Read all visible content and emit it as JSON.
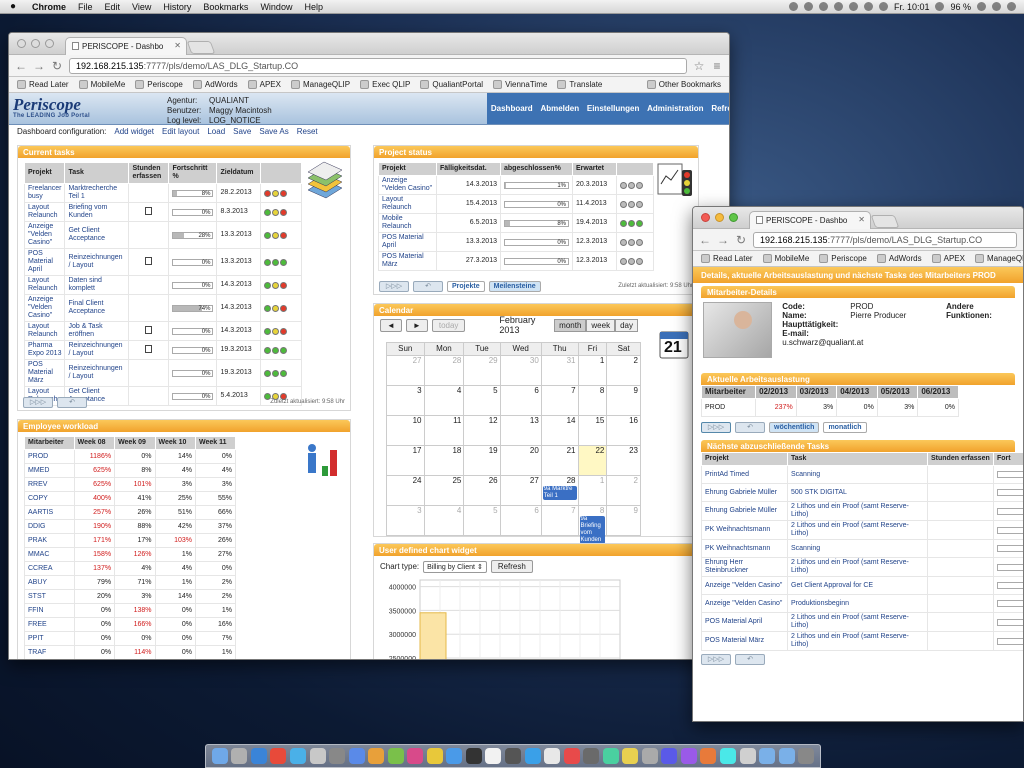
{
  "menubar": {
    "app": "Chrome",
    "items": [
      "File",
      "Edit",
      "View",
      "History",
      "Bookmarks",
      "Window",
      "Help"
    ],
    "battery": "96 %",
    "clock": "Fr. 10:01"
  },
  "browser": {
    "tab_title": "PERISCOPE - Dashbo",
    "url_host": "192.168.215.135",
    "url_path": ":7777/pls/demo/LAS_DLG_Startup.CO",
    "bookmarks": [
      "Read Later",
      "MobileMe",
      "Periscope",
      "AdWords",
      "APEX",
      "ManageQLIP",
      "Exec QLIP",
      "QualiantPortal",
      "ViennaTime",
      "Translate"
    ],
    "bookmarks_other": "Other Bookmarks"
  },
  "app": {
    "logo": "Periscope",
    "tagline": "The LEADING Job Portal",
    "agentur_label": "Agentur:",
    "agentur": "QUALIANT",
    "benutzer_label": "Benutzer:",
    "benutzer": "Maggy Macintosh",
    "loglevel_label": "Log level:",
    "loglevel": "LOG_NOTICE",
    "nav": [
      "Dashboard",
      "Abmelden",
      "Einstellungen",
      "Administration",
      "Refresh"
    ],
    "dashconf_label": "Dashboard configuration:",
    "dashconf": [
      "Add widget",
      "Edit layout",
      "Load",
      "Save",
      "Save As",
      "Reset"
    ]
  },
  "current_tasks": {
    "title": "Current tasks",
    "headers": [
      "Projekt",
      "Task",
      "Stunden erfassen",
      "Fortschritt %",
      "Zieldatum",
      ""
    ],
    "rows": [
      {
        "projekt": "Freelancer busy",
        "task": "Marktrecherche Teil 1",
        "doc": false,
        "pct": 8,
        "pct_label": "8%",
        "date": "28.2.2013",
        "lights": "ryr"
      },
      {
        "projekt": "Layout Relaunch",
        "task": "Briefing vom Kunden",
        "doc": true,
        "pct": 0,
        "pct_label": "0%",
        "date": "8.3.2013",
        "lights": "gyr"
      },
      {
        "projekt": "Anzeige \"Velden Casino\"",
        "task": "Get Client Acceptance",
        "doc": false,
        "pct": 28,
        "pct_label": "28%",
        "date": "13.3.2013",
        "lights": "gyr"
      },
      {
        "projekt": "POS Material April",
        "task": "Reinzeichnungen / Layout",
        "doc": true,
        "pct": 0,
        "pct_label": "0%",
        "date": "13.3.2013",
        "lights": "ggg"
      },
      {
        "projekt": "Layout Relaunch",
        "task": "Daten sind komplett",
        "doc": false,
        "pct": 0,
        "pct_label": "0%",
        "date": "14.3.2013",
        "lights": "gyr"
      },
      {
        "projekt": "Anzeige \"Velden Casino\"",
        "task": "Final Client Acceptance",
        "doc": false,
        "pct": 74,
        "pct_label": "74%",
        "date": "14.3.2013",
        "lights": "gyr"
      },
      {
        "projekt": "Layout Relaunch",
        "task": "Job & Task eröffnen",
        "doc": true,
        "pct": 0,
        "pct_label": "0%",
        "date": "14.3.2013",
        "lights": "gyr"
      },
      {
        "projekt": "Pharma Expo 2013",
        "task": "Reinzeichnungen / Layout",
        "doc": true,
        "pct": 0,
        "pct_label": "0%",
        "date": "19.3.2013",
        "lights": "ggg"
      },
      {
        "projekt": "POS Material März",
        "task": "Reinzeichnungen / Layout",
        "doc": false,
        "pct": 0,
        "pct_label": "0%",
        "date": "19.3.2013",
        "lights": "ggg"
      },
      {
        "projekt": "Layout Relaunch",
        "task": "Get Client Acceptance",
        "doc": false,
        "pct": 0,
        "pct_label": "0%",
        "date": "5.4.2013",
        "lights": "gyr"
      }
    ],
    "updated": "Zuletzt aktualisiert: 9:58 Uhr"
  },
  "employee_workload": {
    "title": "Employee workload",
    "headers": [
      "Mitarbeiter",
      "Week 08",
      "Week 09",
      "Week 10",
      "Week 11"
    ],
    "rows": [
      {
        "name": "PROD",
        "w": [
          "1186%",
          "0%",
          "14%",
          "0%"
        ],
        "red": [
          true,
          false,
          false,
          false
        ]
      },
      {
        "name": "MMED",
        "w": [
          "625%",
          "8%",
          "4%",
          "4%"
        ],
        "red": [
          true,
          false,
          false,
          false
        ]
      },
      {
        "name": "RREV",
        "w": [
          "625%",
          "101%",
          "3%",
          "3%"
        ],
        "red": [
          true,
          true,
          false,
          false
        ]
      },
      {
        "name": "COPY",
        "w": [
          "400%",
          "41%",
          "25%",
          "55%"
        ],
        "red": [
          true,
          false,
          false,
          false
        ]
      },
      {
        "name": "AARTIS",
        "w": [
          "257%",
          "26%",
          "51%",
          "66%"
        ],
        "red": [
          true,
          false,
          false,
          false
        ]
      },
      {
        "name": "DDIG",
        "w": [
          "190%",
          "88%",
          "42%",
          "37%"
        ],
        "red": [
          true,
          false,
          false,
          false
        ]
      },
      {
        "name": "PRAK",
        "w": [
          "171%",
          "17%",
          "103%",
          "26%"
        ],
        "red": [
          true,
          false,
          true,
          false
        ]
      },
      {
        "name": "MMAC",
        "w": [
          "158%",
          "126%",
          "1%",
          "27%"
        ],
        "red": [
          true,
          true,
          false,
          false
        ]
      },
      {
        "name": "CCREA",
        "w": [
          "137%",
          "4%",
          "4%",
          "0%"
        ],
        "red": [
          true,
          false,
          false,
          false
        ]
      },
      {
        "name": "ABUY",
        "w": [
          "79%",
          "71%",
          "1%",
          "2%"
        ],
        "red": [
          false,
          false,
          false,
          false
        ]
      },
      {
        "name": "STST",
        "w": [
          "20%",
          "3%",
          "14%",
          "2%"
        ],
        "red": [
          false,
          false,
          false,
          false
        ]
      },
      {
        "name": "FFIN",
        "w": [
          "0%",
          "138%",
          "0%",
          "1%"
        ],
        "red": [
          false,
          true,
          false,
          false
        ]
      },
      {
        "name": "FREE",
        "w": [
          "0%",
          "166%",
          "0%",
          "16%"
        ],
        "red": [
          false,
          true,
          false,
          false
        ]
      },
      {
        "name": "PPIT",
        "w": [
          "0%",
          "0%",
          "0%",
          "7%"
        ],
        "red": [
          false,
          false,
          false,
          false
        ]
      },
      {
        "name": "TRAF",
        "w": [
          "0%",
          "114%",
          "0%",
          "1%"
        ],
        "red": [
          false,
          true,
          false,
          false
        ]
      }
    ]
  },
  "project_status": {
    "title": "Project status",
    "headers": [
      "Projekt",
      "Fälligkeitsdat.",
      "abgeschlossen%",
      "Erwartet",
      ""
    ],
    "rows": [
      {
        "projekt": "Anzeige \"Velden Casino\"",
        "date": "14.3.2013",
        "pct": 1,
        "pct_label": "1%",
        "exp": "20.3.2013",
        "lights": "nnn"
      },
      {
        "projekt": "Layout Relaunch",
        "date": "15.4.2013",
        "pct": 0,
        "pct_label": "0%",
        "exp": "11.4.2013",
        "lights": "nnn"
      },
      {
        "projekt": "Mobile Relaunch",
        "date": "6.5.2013",
        "pct": 8,
        "pct_label": "8%",
        "exp": "19.4.2013",
        "lights": "ggg"
      },
      {
        "projekt": "POS Material April",
        "date": "13.3.2013",
        "pct": 0,
        "pct_label": "0%",
        "exp": "12.3.2013",
        "lights": "nnn"
      },
      {
        "projekt": "POS Material März",
        "date": "27.3.2013",
        "pct": 0,
        "pct_label": "0%",
        "exp": "12.3.2013",
        "lights": "nnn"
      }
    ],
    "tabs": [
      "Projekte",
      "Meilensteine"
    ],
    "updated": "Zuletzt aktualisiert: 9:58 Uhr"
  },
  "calendar": {
    "title": "Calendar",
    "today_label": "today",
    "month_title": "February 2013",
    "views": [
      "month",
      "week",
      "day"
    ],
    "weekdays": [
      "Sun",
      "Mon",
      "Tue",
      "Wed",
      "Thu",
      "Fri",
      "Sat"
    ],
    "weeks": [
      [
        "27",
        "28",
        "29",
        "30",
        "31",
        "1",
        "2"
      ],
      [
        "3",
        "4",
        "5",
        "6",
        "7",
        "8",
        "9"
      ],
      [
        "10",
        "11",
        "12",
        "13",
        "14",
        "15",
        "16"
      ],
      [
        "17",
        "18",
        "19",
        "20",
        "21",
        "22",
        "23"
      ],
      [
        "24",
        "25",
        "26",
        "27",
        "28",
        "1",
        "2"
      ],
      [
        "3",
        "4",
        "5",
        "6",
        "7",
        "8",
        "9"
      ]
    ],
    "events": [
      {
        "week": 4,
        "day": 4,
        "text": "9a Marktre Teil 1"
      },
      {
        "week": 5,
        "day": 5,
        "text": "9a Briefing vom Kunden"
      }
    ],
    "badge_day": "21"
  },
  "chart_widget": {
    "title": "User defined chart widget",
    "label": "Chart type:",
    "selected": "Billing by Client",
    "refresh": "Refresh"
  },
  "chart_data": {
    "type": "bar",
    "yticks": [
      4000000,
      3500000,
      3000000,
      2500000
    ],
    "ylim": [
      2500000,
      4000000
    ],
    "values": [
      3450000
    ]
  },
  "detail": {
    "tab_title": "PERISCOPE - Dashbo",
    "url_host": "192.168.215.135",
    "url_path": ":7777/pls/demo/LAS_DLG_Startup.CO",
    "bookmarks": [
      "Read Later",
      "MobileMe",
      "Periscope",
      "AdWords",
      "APEX",
      "ManageQLIP"
    ],
    "title": "Details, aktuelle Arbeitsauslastung und nächste Tasks des Mitarbeiters PROD",
    "emp_section": "Mitarbeiter-Details",
    "fields": [
      {
        "k": "Code:",
        "v": "PROD"
      },
      {
        "k": "Name:",
        "v": "Pierre Producer"
      },
      {
        "k": "Haupttätigkeit:",
        "v": ""
      },
      {
        "k": "E-mail:",
        "v": "u.schwarz@qualiant.at"
      }
    ],
    "other_label": "Andere Funktionen:",
    "load_section": "Aktuelle Arbeitsauslastung",
    "load_headers": [
      "Mitarbeiter",
      "02/2013",
      "03/2013",
      "04/2013",
      "05/2013",
      "06/2013"
    ],
    "load_row": {
      "name": "PROD",
      "v": [
        "237%",
        "3%",
        "0%",
        "3%",
        "0%"
      ]
    },
    "load_tabs": [
      "wöchentlich",
      "monatlich"
    ],
    "tasks_section": "Nächste abzuschließende Tasks",
    "tasks_headers": [
      "Projekt",
      "Task",
      "Stunden erfassen",
      "Fort"
    ],
    "tasks": [
      {
        "p": "PrintAd Timed",
        "t": "Scanning"
      },
      {
        "p": "Ehrung Gabriele Müller",
        "t": "500 STK DIGITAL"
      },
      {
        "p": "Ehrung Gabriele Müller",
        "t": "2 Lithos und ein Proof (samt Reserve-Litho)"
      },
      {
        "p": "PK Weihnachtsmann",
        "t": "2 Lithos und ein Proof (samt Reserve-Litho)"
      },
      {
        "p": "PK Weihnachtsmann",
        "t": "Scanning"
      },
      {
        "p": "Ehrung Herr Steinbruckner",
        "t": "2 Lithos und ein Proof (samt Reserve-Litho)"
      },
      {
        "p": "Anzeige \"Velden Casino\"",
        "t": "Get Client Approval for CE"
      },
      {
        "p": "Anzeige \"Velden Casino\"",
        "t": "Produktionsbeginn"
      },
      {
        "p": "POS Material April",
        "t": "2 Lithos und ein Proof (samt Reserve-Litho)"
      },
      {
        "p": "POS Material März",
        "t": "2 Lithos und ein Proof (samt Reserve-Litho)"
      }
    ]
  }
}
